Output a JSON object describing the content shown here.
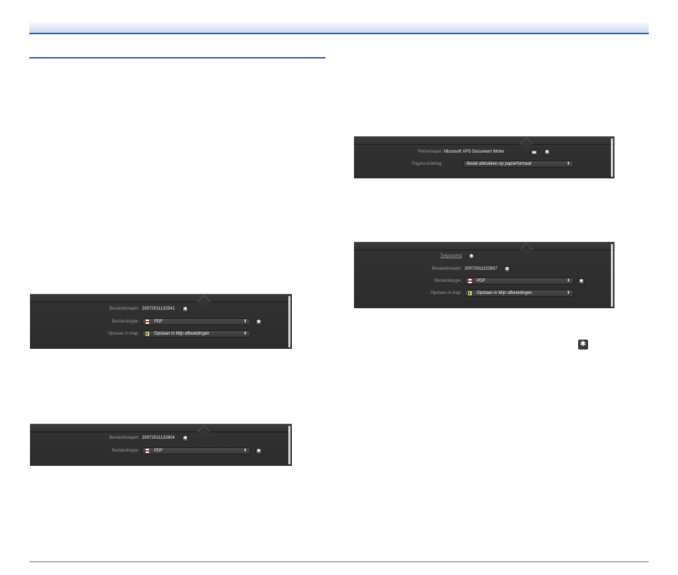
{
  "panels": {
    "printer": {
      "printer_label": "Printernaam:",
      "printer_value": "Microsoft XPS Document Writer",
      "layout_label": "Pagina-indeling:",
      "layout_value": "Beeld afdrukken op papierformaat"
    },
    "application": {
      "app_label": "Toepassing",
      "filename_label": "Bestandsnaam:",
      "filename_value": "20072011132637",
      "filetype_label": "Bestandstype:",
      "filetype_value": "PDF",
      "folder_label": "Opslaan in map:",
      "folder_value": "Opslaan in Mijn afbeeldingen"
    },
    "save_folder": {
      "filename_label": "Bestandsnaam:",
      "filename_value": "20072011132541",
      "filetype_label": "Bestandstype:",
      "filetype_value": "PDF",
      "folder_label": "Opslaan in map:",
      "folder_value": "Opslaan in Mijn afbeeldingen"
    },
    "save_basic": {
      "filename_label": "Bestandsnaam:",
      "filename_value": "20072011132604",
      "filetype_label": "Bestandstype:",
      "filetype_value": "PDF"
    }
  },
  "icons": {
    "settings": "gear-icon",
    "printer": "printer-icon",
    "pdf": "pdf-file-icon",
    "folder": "folder-icon",
    "dropdown": "dropdown-arrows-icon",
    "settings_glyph": "✱",
    "dropdown_glyph": "⬍"
  },
  "colors": {
    "accent": "#2f5fa6",
    "panel_bg": "#2e2e2e",
    "label_text": "#9a9a9a",
    "value_text": "#f2f2f2"
  }
}
